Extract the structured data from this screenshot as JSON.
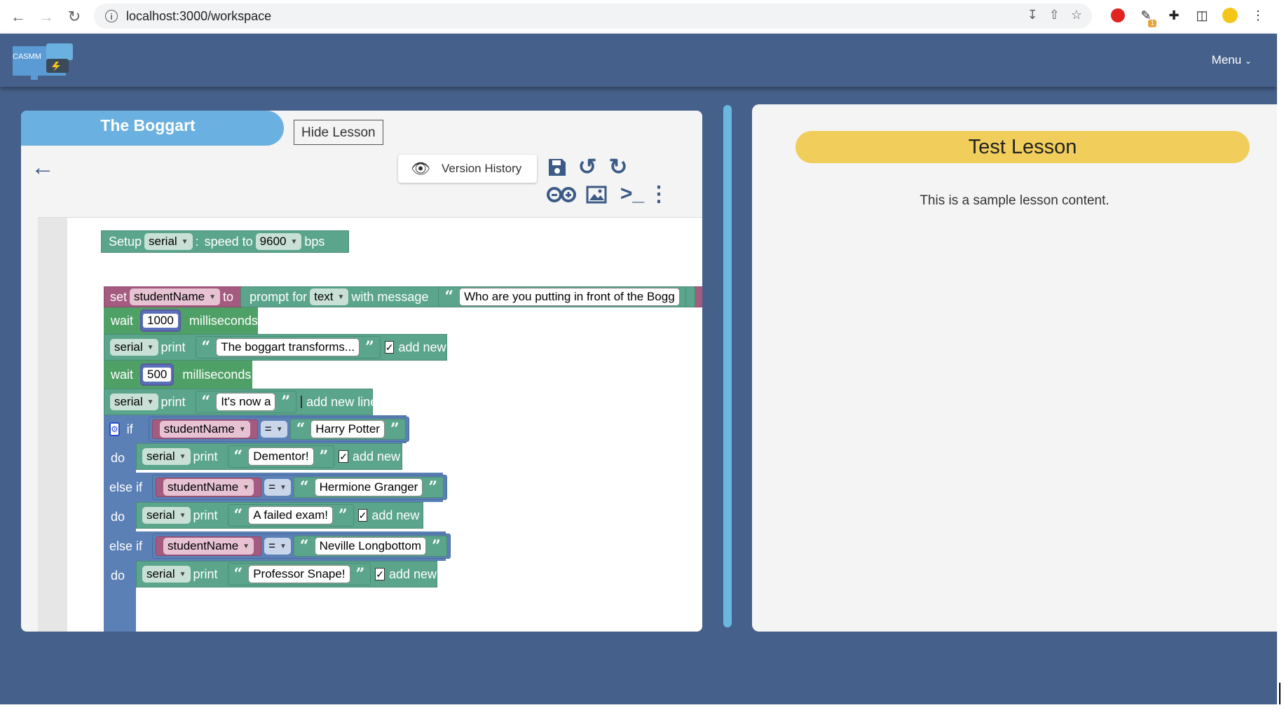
{
  "browser": {
    "url": "localhost:3000/workspace",
    "extension_badge": "1"
  },
  "app": {
    "logo_text": "CASMM",
    "menu_label": "Menu"
  },
  "workspace": {
    "title": "The Boggart",
    "hide_lesson": "Hide Lesson",
    "version_history": "Version History",
    "blocks": {
      "setup": {
        "label": "Setup",
        "port": "serial",
        "colon": ":",
        "speed": "speed to",
        "baud": "9600",
        "unit": "bps"
      },
      "set_var": {
        "set": "set",
        "var": "studentName",
        "to": "to",
        "prompt": "prompt for",
        "type": "text",
        "with_msg": "with message",
        "message": "Who are you putting in front of the Bogg"
      },
      "wait1": {
        "wait": "wait",
        "ms": "1000",
        "unit": "milliseconds"
      },
      "print1": {
        "port": "serial",
        "print": "print",
        "text": "The boggart transforms...",
        "newline": "add new line",
        "checked": true
      },
      "wait2": {
        "wait": "wait",
        "ms": "500",
        "unit": "milliseconds"
      },
      "print2": {
        "port": "serial",
        "print": "print",
        "text": "It's now a",
        "newline": "add new line",
        "checked": false
      },
      "if_block": {
        "if": "if",
        "else_if": "else if",
        "do": "do",
        "op": "=",
        "branches": [
          {
            "var": "studentName",
            "value": "Harry Potter",
            "port": "serial",
            "print": "print",
            "output": "Dementor!",
            "newline": "add new line"
          },
          {
            "var": "studentName",
            "value": "Hermione Granger",
            "port": "serial",
            "print": "print",
            "output": "A failed exam!",
            "newline": "add new line"
          },
          {
            "var": "studentName",
            "value": "Neville Longbottom",
            "port": "serial",
            "print": "print",
            "output": "Professor Snape!",
            "newline": "add new line"
          }
        ]
      }
    }
  },
  "lesson": {
    "title": "Test Lesson",
    "body": "This is a sample lesson content."
  },
  "colors": {
    "app_bg": "#45608a",
    "lesson_title_bg": "#f1ce5c",
    "tab_bg": "#6ab0e0",
    "block_green": "#5ba58c",
    "block_blue": "#5b80b6",
    "block_pink": "#a55b80"
  }
}
